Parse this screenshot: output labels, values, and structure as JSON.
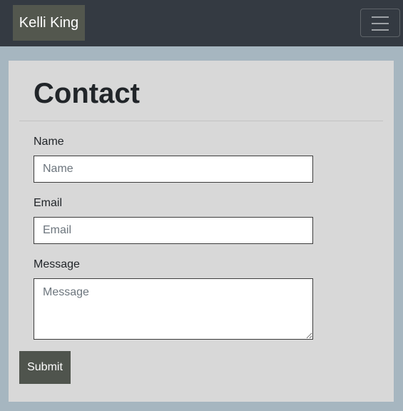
{
  "navbar": {
    "brand": "Kelli King",
    "toggler_icon": "hamburger-icon"
  },
  "page": {
    "title": "Contact"
  },
  "form": {
    "name_label": "Name",
    "name_placeholder": "Name",
    "name_value": "",
    "email_label": "Email",
    "email_placeholder": "Email",
    "email_value": "",
    "message_label": "Message",
    "message_placeholder": "Message",
    "message_value": "",
    "submit_label": "Submit"
  },
  "colors": {
    "page_background": "#a6b6c0",
    "navbar_background": "#343a42",
    "brand_background": "#53574e",
    "card_background": "#d8d8d8",
    "submit_background": "#4f544d"
  }
}
